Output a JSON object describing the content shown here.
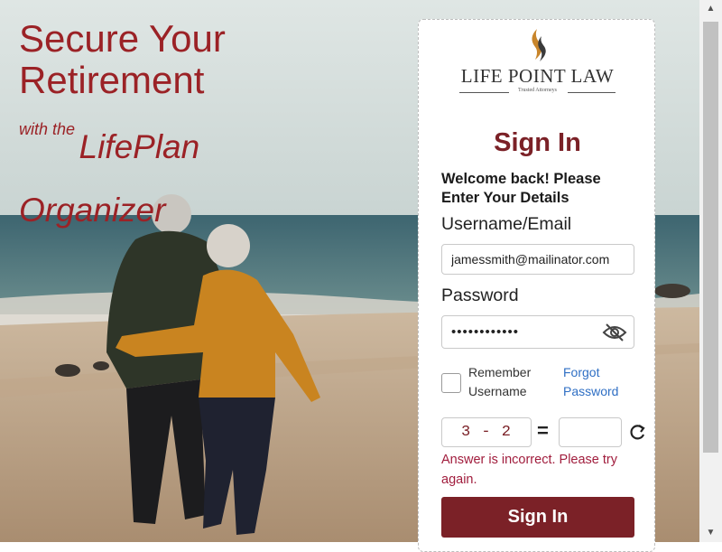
{
  "hero": {
    "title_line1": "Secure Your",
    "title_line2": "Retirement",
    "subtitle_prefix": "with the",
    "subtitle_product": "LifePlan",
    "subtitle_suffix": "Organizer"
  },
  "brand": {
    "name": "LIFE POINT LAW",
    "tagline": "Trusted Attorneys",
    "accent_color": "#7b2127",
    "logo_color": "#c8852b"
  },
  "login": {
    "title": "Sign In",
    "welcome": "Welcome back! Please Enter Your Details",
    "username_label": "Username/Email",
    "username_value": "jamessmith@mailinator.com",
    "password_label": "Password",
    "password_value": "••••••••••••",
    "remember_label": "Remember Username",
    "forgot_label": "Forgot Password",
    "captcha_question": "3 - 2",
    "captcha_equals": "=",
    "captcha_answer": "",
    "error_message": "Answer is incorrect. Please try again.",
    "submit_label": "Sign In",
    "password_visibility_icon": "eye-slash-icon",
    "refresh_icon": "refresh-icon"
  },
  "scrollbar": {
    "up_arrow": "▲",
    "down_arrow": "▼"
  }
}
